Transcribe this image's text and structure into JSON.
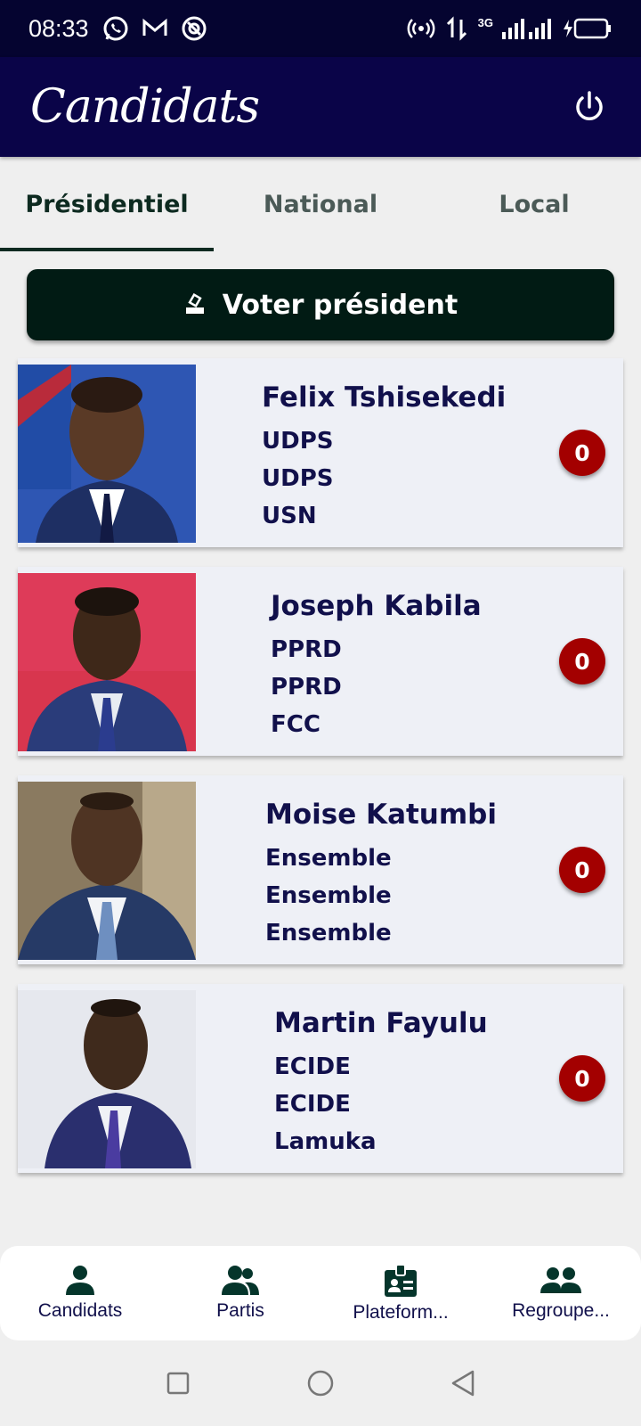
{
  "status_bar": {
    "time": "08:33",
    "network": "3G",
    "icons_left": [
      "whatsapp-icon",
      "gmail-icon",
      "vpn-icon"
    ],
    "icons_right": [
      "hotspot-icon",
      "data-transfer-icon",
      "signal-icon",
      "battery-charging-icon"
    ]
  },
  "app_bar": {
    "title": "Candidats",
    "power_icon": "power-icon"
  },
  "tabs": [
    {
      "label": "Présidentiel",
      "active": true
    },
    {
      "label": "National",
      "active": false
    },
    {
      "label": "Local",
      "active": false
    }
  ],
  "vote_button": {
    "label": "Voter président",
    "icon": "ballot-icon"
  },
  "candidates": [
    {
      "name": "Felix Tshisekedi",
      "lines": [
        "UDPS",
        "UDPS",
        "USN"
      ],
      "votes": "0"
    },
    {
      "name": "Joseph Kabila",
      "lines": [
        "PPRD",
        "PPRD",
        "FCC"
      ],
      "votes": "0"
    },
    {
      "name": "Moise Katumbi",
      "lines": [
        "Ensemble",
        "Ensemble",
        "Ensemble"
      ],
      "votes": "0"
    },
    {
      "name": "Martin Fayulu",
      "lines": [
        "ECIDE",
        "ECIDE",
        "Lamuka"
      ],
      "votes": "0"
    }
  ],
  "bottom_nav": [
    {
      "label": "Candidats",
      "icon": "person-icon"
    },
    {
      "label": "Partis",
      "icon": "group-icon"
    },
    {
      "label": "Plateform...",
      "icon": "badge-icon"
    },
    {
      "label": "Regroupe...",
      "icon": "people-icon"
    }
  ],
  "colors": {
    "app_bar": "#0a0448",
    "status_bar": "#050430",
    "vote_button": "#011b14",
    "badge": "#a30000",
    "text_dark": "#11104b"
  }
}
